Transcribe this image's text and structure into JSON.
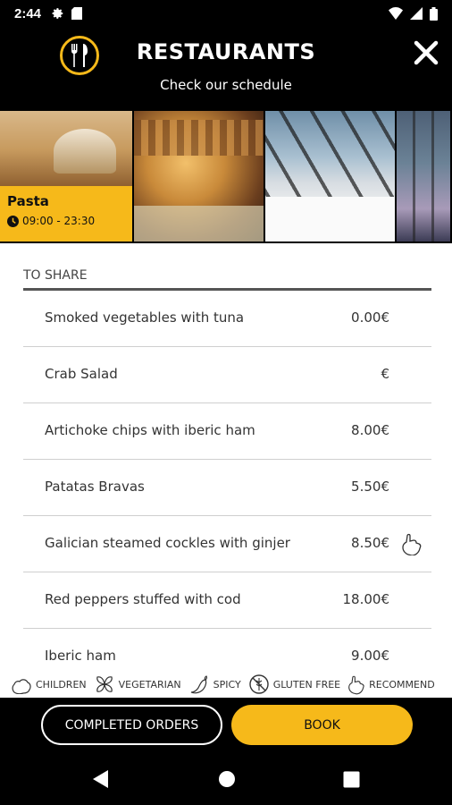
{
  "status_bar": {
    "time": "2:44"
  },
  "header": {
    "title": "RESTAURANTS",
    "subtitle": "Check our schedule"
  },
  "restaurant": {
    "name": "Pasta",
    "hours": "09:00 - 23:30"
  },
  "menu": {
    "section_title": "TO SHARE",
    "items": [
      {
        "name": "Smoked vegetables with tuna",
        "price": "0.00€"
      },
      {
        "name": "Crab Salad",
        "price": "€"
      },
      {
        "name": "Artichoke chips with iberic ham",
        "price": "8.00€"
      },
      {
        "name": "Patatas Bravas",
        "price": "5.50€"
      },
      {
        "name": "Galician steamed cockles with ginjer",
        "price": "8.50€",
        "icon": "recommended-icon"
      },
      {
        "name": "Red peppers stuffed with cod",
        "price": "18.00€"
      },
      {
        "name": "Iberic ham",
        "price": "9.00€"
      }
    ]
  },
  "legend": {
    "children": "CHILDREN",
    "vegetarian": "VEGETARIAN",
    "spicy": "SPICY",
    "gluten_free": "GLUTEN FREE",
    "recommended": "RECOMMEND"
  },
  "actions": {
    "completed_orders": "COMPLETED ORDERS",
    "book": "BOOK"
  },
  "colors": {
    "accent": "#f6b91a",
    "background": "#000000",
    "sheet": "#ffffff"
  }
}
